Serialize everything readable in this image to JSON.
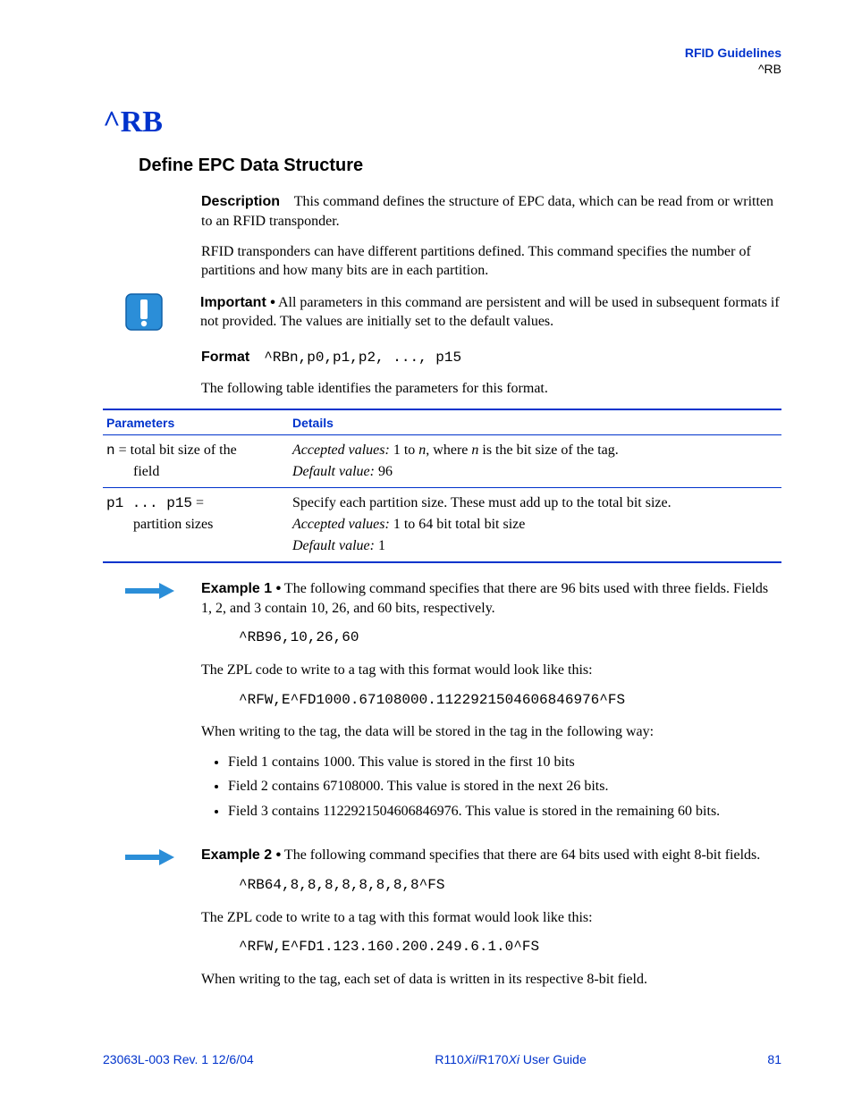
{
  "header": {
    "guide": "RFID Guidelines",
    "cmd": "^RB"
  },
  "title": "^RB",
  "subtitle": "Define EPC Data Structure",
  "description": {
    "label": "Description",
    "text1_after": "This command defines the structure of EPC data, which can be read from or written to an RFID transponder.",
    "text2": "RFID transponders can have different partitions defined. This command specifies the number of partitions and how many bits are in each partition."
  },
  "important": {
    "label": "Important •",
    "text": "All parameters in this command are persistent and will be used in subsequent formats if not provided. The values are initially set to the default values."
  },
  "format": {
    "label": "Format",
    "code": "^RBn,p0,p1,p2, ..., p15"
  },
  "table_intro": "The following table identifies the parameters for this format.",
  "table": {
    "headers": [
      "Parameters",
      "Details"
    ],
    "rows": [
      {
        "param_code": "n",
        "param_eq": " = ",
        "param_desc": "total bit size of the field",
        "details_1_pre": "Accepted values:",
        "details_1_mid": " 1 to ",
        "details_1_var": "n",
        "details_1_post": ", where ",
        "details_1_var2": "n",
        "details_1_end": " is the bit size of the tag.",
        "details_2_pre": "Default value:",
        "details_2_val": " 96"
      },
      {
        "param_code": "p1 ... p15",
        "param_eq": " = ",
        "param_desc": "partition sizes",
        "details_0": "Specify each partition size. These must add up to the total bit size.",
        "details_1_pre": "Accepted values:",
        "details_1_val": " 1 to 64 bit total bit size",
        "details_2_pre": "Default value:",
        "details_2_val": " 1"
      }
    ]
  },
  "example1": {
    "label": "Example 1 •",
    "intro": "The following command specifies that there are 96 bits used with three fields. Fields 1, 2, and 3 contain 10, 26, and 60 bits, respectively.",
    "code1": "^RB96,10,26,60",
    "zpl_intro": "The ZPL code to write to a tag with this format would look like this:",
    "code2": "^RFW,E^FD1000.67108000.1122921504606846976^FS",
    "store_intro": "When writing to the tag, the data will be stored in the tag in the following way:",
    "bullets": [
      "Field 1 contains 1000. This value is stored in the first 10 bits",
      "Field 2 contains 67108000. This value is stored in the next 26 bits.",
      "Field 3 contains 1122921504606846976. This value is stored in the remaining 60 bits."
    ]
  },
  "example2": {
    "label": "Example 2 •",
    "intro": "The following command specifies that there are 64 bits used with eight 8-bit fields.",
    "code1": "^RB64,8,8,8,8,8,8,8,8^FS",
    "zpl_intro": "The ZPL code to write to a tag with this format would look like this:",
    "code2": "^RFW,E^FD1.123.160.200.249.6.1.0^FS",
    "store_intro": "When writing to the tag, each set of data is written in its respective 8-bit field."
  },
  "footer": {
    "left": "23063L-003 Rev. 1   12/6/04",
    "center_pre": "R110",
    "center_i1": "Xi",
    "center_mid": "/R170",
    "center_i2": "Xi",
    "center_post": " User Guide",
    "right": "81"
  }
}
